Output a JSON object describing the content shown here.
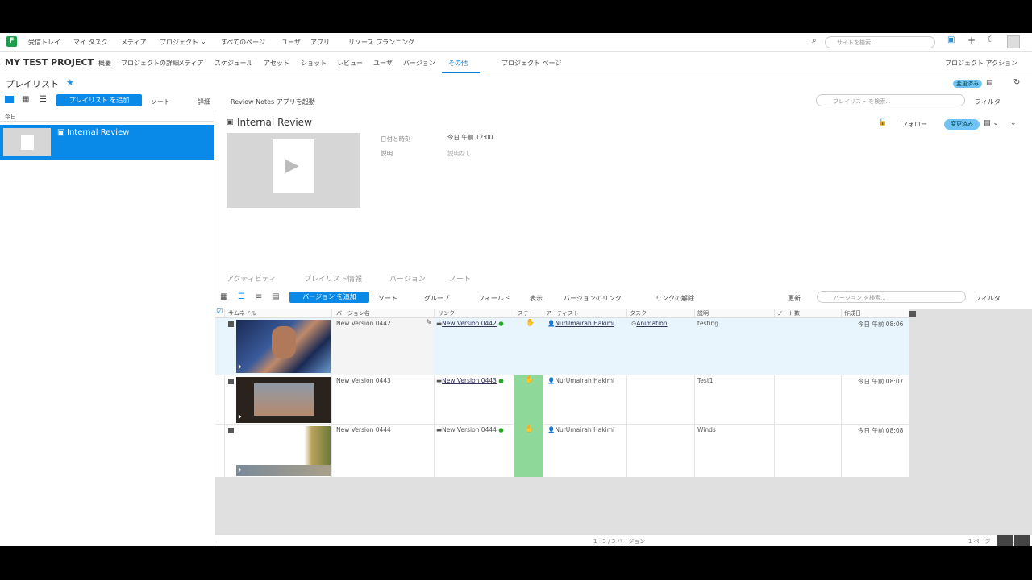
{
  "topnav": {
    "items": [
      "受信トレイ",
      "マイ タスク",
      "メディア",
      "プロジェクト",
      "すべてのページ",
      "ユーザ",
      "アプリ",
      "リソース プランニング"
    ],
    "search_placeholder": "サイトを検索..."
  },
  "project": {
    "title": "MY TEST PROJECT",
    "tabs": [
      "概要",
      "プロジェクトの詳細",
      "メディア",
      "スケジュール",
      "アセット",
      "ショット",
      "レビュー",
      "ユーザ",
      "バージョン",
      "その他",
      "プロジェクト ページ"
    ],
    "actions_label": "プロジェクト アクション"
  },
  "page": {
    "title": "プレイリスト",
    "add_playlist": "プレイリスト を追加",
    "sort": "ソート",
    "more": "詳細",
    "review_notes": "Review Notes アプリを起動",
    "search_placeholder": "プレイリスト を検索...",
    "filter": "フィルタ",
    "status_badge": "変更済み"
  },
  "sidebar": {
    "group_label": "今日",
    "selected_item": "Internal Review"
  },
  "detail": {
    "title": "Internal Review",
    "date_label": "日付と時刻",
    "date_value": "今日 午前 12:00",
    "desc_label": "説明",
    "desc_value": "説明なし",
    "follow": "フォロー",
    "status_badge": "変更済み",
    "tabs": [
      "アクティビティ",
      "プレイリスト情報",
      "バージョン",
      "ノート"
    ]
  },
  "versions_toolbar": {
    "add_version": "バージョン を追加",
    "sort": "ソート",
    "group": "グループ",
    "fields": "フィールド",
    "display": "表示",
    "link_versions": "バージョンのリンク",
    "remove_link": "リンクの解除",
    "update": "更新",
    "search_placeholder": "バージョン を検索...",
    "filter": "フィルタ"
  },
  "grid": {
    "headers": [
      "サムネイル",
      "バージョン名",
      "リンク",
      "ステー",
      "アーティスト",
      "タスク",
      "説明",
      "ノート数",
      "作成日"
    ],
    "rows": [
      {
        "name": "New Version 0442",
        "link": "New Version 0442",
        "artist": "NurUmairah Hakimi",
        "task": "Animation",
        "desc": "testing",
        "date": "今日 午前 08:06"
      },
      {
        "name": "New Version 0443",
        "link": "New Version 0443",
        "artist": "NurUmairah Hakimi",
        "task": "",
        "desc": "Test1",
        "date": "今日 午前 08:07"
      },
      {
        "name": "New Version 0444",
        "link": "New Version 0444",
        "artist": "NurUmairah Hakimi",
        "task": "",
        "desc": "Winds",
        "date": "今日 午前 08:08"
      }
    ]
  },
  "footer": {
    "count": "1 - 3 / 3 バージョン",
    "page": "1 ページ"
  },
  "colors": {
    "accent": "#0a8ae8",
    "status_green": "#8ed99a",
    "selected_row": "#e8f5fd"
  }
}
